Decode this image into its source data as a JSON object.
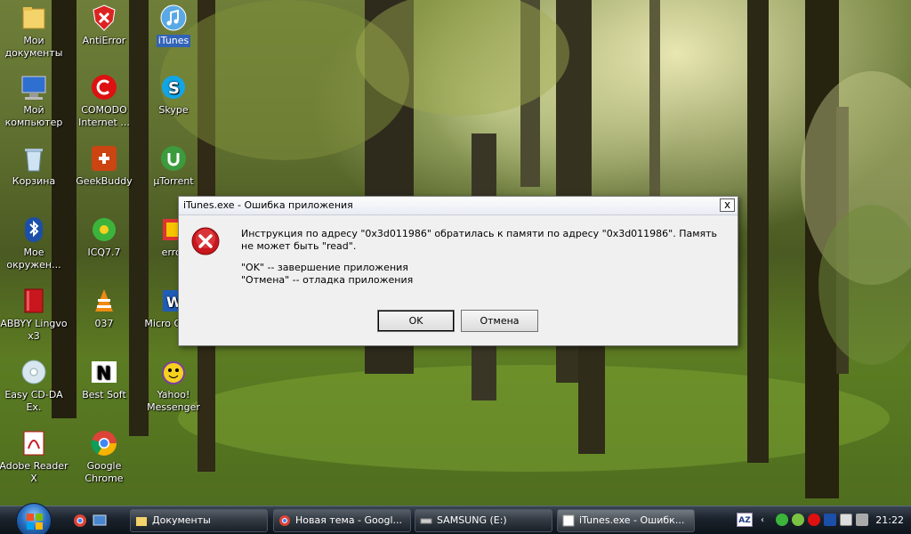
{
  "desktop": {
    "icons": [
      {
        "label": "Мои документы"
      },
      {
        "label": "AntiError"
      },
      {
        "label": "iTunes"
      },
      {
        "label": "Мой компьютер"
      },
      {
        "label": "COMODO Internet ..."
      },
      {
        "label": "Skype"
      },
      {
        "label": "Корзина"
      },
      {
        "label": "GeekBuddy"
      },
      {
        "label": "µTorrent"
      },
      {
        "label": "Мое окружен..."
      },
      {
        "label": "ICQ7.7"
      },
      {
        "label": "error"
      },
      {
        "label": "ABBYY Lingvo x3"
      },
      {
        "label": "037"
      },
      {
        "label": "Micro Office"
      },
      {
        "label": "Easy CD-DA Ex."
      },
      {
        "label": "Best Soft"
      },
      {
        "label": "Yahoo! Messenger"
      },
      {
        "label": "Adobe Reader X"
      },
      {
        "label": "Google Chrome"
      }
    ]
  },
  "dialog": {
    "title": "iTunes.exe - Ошибка приложения",
    "close_label": "x",
    "message_line1": "Инструкция по адресу \"0x3d011986\" обратилась к памяти по адресу \"0x3d011986\". Память не может быть \"read\".",
    "message_line2": "\"OK\" -- завершение приложения",
    "message_line3": "\"Отмена\" -- отладка приложения",
    "ok_label": "OK",
    "cancel_label": "Отмена"
  },
  "taskbar": {
    "buttons": [
      {
        "label": "Документы"
      },
      {
        "label": "Новая тема - Googl..."
      },
      {
        "label": "SAMSUNG (E:)"
      },
      {
        "label": "iTunes.exe - Ошибк..."
      }
    ],
    "language": "AZ",
    "clock": "21:22"
  },
  "colors": {
    "selection": "#3163b8",
    "error_red": "#c8171d"
  }
}
